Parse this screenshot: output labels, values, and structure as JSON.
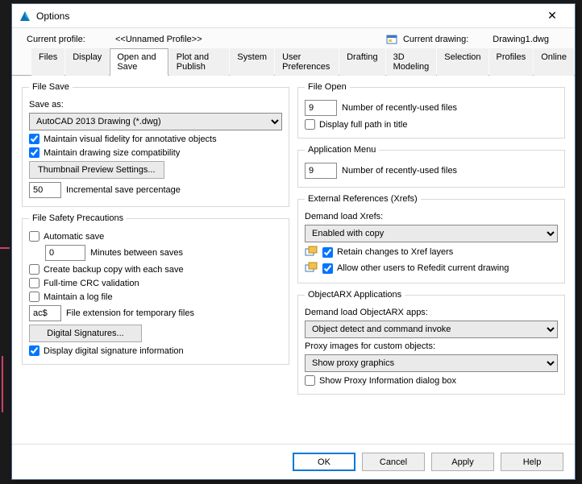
{
  "window": {
    "title": "Options"
  },
  "profile": {
    "label": "Current profile:",
    "value": "<<Unnamed Profile>>",
    "drawing_label": "Current drawing:",
    "drawing_value": "Drawing1.dwg"
  },
  "tabs": [
    "Files",
    "Display",
    "Open and Save",
    "Plot and Publish",
    "System",
    "User Preferences",
    "Drafting",
    "3D Modeling",
    "Selection",
    "Profiles",
    "Online"
  ],
  "file_save": {
    "legend": "File Save",
    "save_as_label": "Save as:",
    "save_as_value": "AutoCAD 2013 Drawing (*.dwg)",
    "maintain_visual": "Maintain visual fidelity for annotative objects",
    "maintain_size": "Maintain drawing size compatibility",
    "thumb_btn": "Thumbnail Preview Settings...",
    "inc_value": "50",
    "inc_label": "Incremental save percentage"
  },
  "file_safety": {
    "legend": "File Safety Precautions",
    "auto_save": "Automatic save",
    "minutes_value": "0",
    "minutes_label": "Minutes between saves",
    "backup": "Create backup copy with each save",
    "crc": "Full-time CRC validation",
    "logfile": "Maintain a log file",
    "ext_value": "ac$",
    "ext_label": "File extension for temporary files",
    "digsig_btn": "Digital Signatures...",
    "disp_digsig": "Display digital signature information"
  },
  "file_open": {
    "legend": "File Open",
    "recent_value": "9",
    "recent_label": "Number of recently-used files",
    "full_path": "Display full path in title"
  },
  "app_menu": {
    "legend": "Application Menu",
    "recent_value": "9",
    "recent_label": "Number of recently-used files"
  },
  "xrefs": {
    "legend": "External References (Xrefs)",
    "demand_label": "Demand load Xrefs:",
    "demand_value": "Enabled with copy",
    "retain": "Retain changes to Xref layers",
    "allow_refedit": "Allow other users to Refedit current drawing"
  },
  "arx": {
    "legend": "ObjectARX Applications",
    "demand_label": "Demand load ObjectARX apps:",
    "demand_value": "Object detect and command invoke",
    "proxy_label": "Proxy images for custom objects:",
    "proxy_value": "Show proxy graphics",
    "show_proxy_info": "Show Proxy Information dialog box"
  },
  "buttons": {
    "ok": "OK",
    "cancel": "Cancel",
    "apply": "Apply",
    "help": "Help"
  }
}
